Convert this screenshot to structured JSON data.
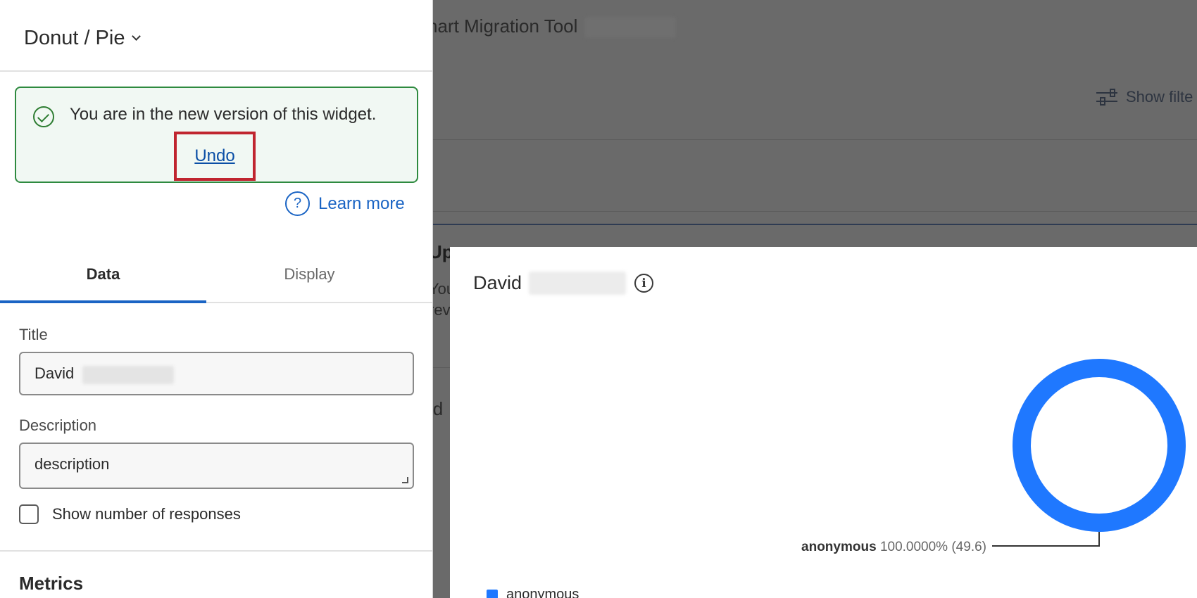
{
  "panel": {
    "widget_type": "Donut / Pie",
    "notice": {
      "message": "You are in the new version of this widget.",
      "undo_label": "Undo"
    },
    "learn_more": "Learn more",
    "tabs": [
      {
        "label": "Data",
        "active": true
      },
      {
        "label": "Display",
        "active": false
      }
    ],
    "title_field": {
      "label": "Title",
      "value": "David"
    },
    "description_field": {
      "label": "Description",
      "value": "description"
    },
    "show_responses_label": "Show number of responses",
    "show_responses_checked": false,
    "metrics_title": "Metrics"
  },
  "background": {
    "page_title": "hart Migration Tool",
    "show_filters": "Show filte",
    "section_heading": "Up",
    "section_text_1": "You",
    "section_text_2": "rev",
    "item_label": "id"
  },
  "widget": {
    "title": "David",
    "legend_label": "anonymous"
  },
  "chart_data": {
    "type": "pie",
    "variant": "donut",
    "categories": [
      "anonymous"
    ],
    "values": [
      49.6
    ],
    "percent_labels": [
      "100.0000%"
    ],
    "value_labels": [
      "(49.6)"
    ],
    "colors": [
      "#1f78ff"
    ],
    "legend_position": "bottom-left"
  },
  "colors": {
    "accent": "#1a64c4",
    "success": "#2e8a3f",
    "highlight_box": "#c0252f",
    "series": "#1f78ff"
  }
}
